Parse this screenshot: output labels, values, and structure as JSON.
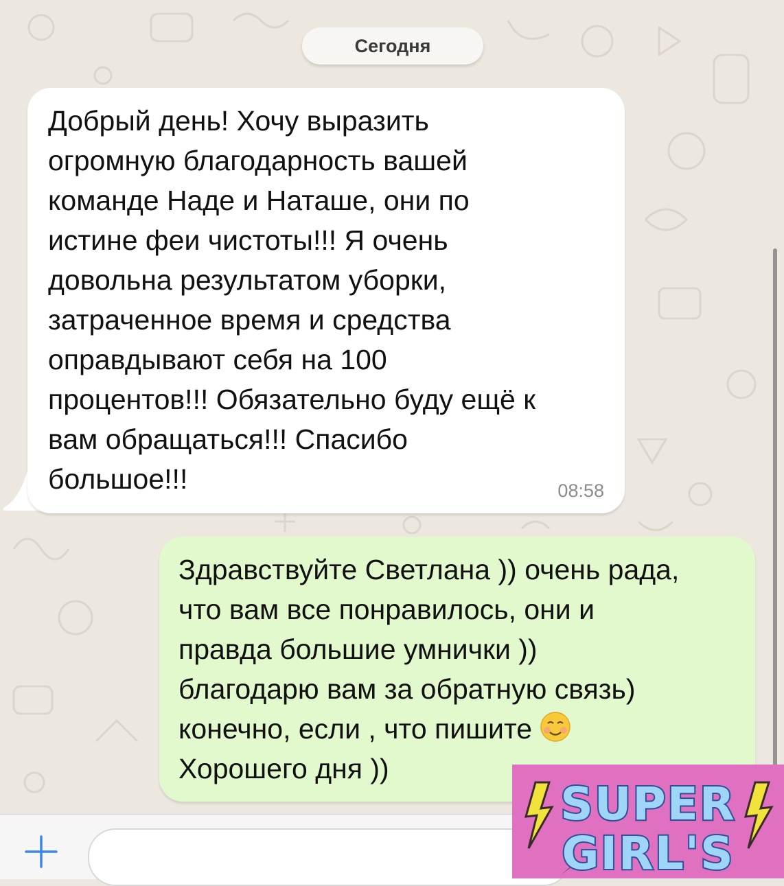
{
  "chat": {
    "date_separator": "Сегодня",
    "messages": [
      {
        "direction": "incoming",
        "text": "Добрый день! Хочу выразить\nогромную благодарность вашей\nкоманде Наде и Наташе, они по\nистине феи чистоты!!! Я очень\nдовольна результатом уборки,\nзатраченное время и средства\nоправдывают себя на 100\nпроцентов!!! Обязательно буду ещё к\nвам обращаться!!! Спасибо\nбольшое!!!",
        "time": "08:58"
      },
      {
        "direction": "outgoing",
        "text_before_emoji": "Здравствуйте Светлана )) очень рада,\nчто вам все понравилось, они и\nправда большие умнички ))\nблагодарю вам за обратную связь)\nконечно, если , что пишите ",
        "emoji": "smiling-face-emoji",
        "text_after_emoji": "\nХорошего дня ))"
      }
    ]
  },
  "input_bar": {
    "attach_icon": "plus-icon",
    "placeholder": ""
  },
  "overlay_logo": {
    "line1": "SUPER",
    "line2": "GIRL'S",
    "background": "#e070c0",
    "accent": "#f1e23c"
  },
  "colors": {
    "chat_background": "#ece7df",
    "incoming_bubble": "#ffffff",
    "outgoing_bubble": "#e2f8cd",
    "accent_blue": "#3b87ea"
  }
}
